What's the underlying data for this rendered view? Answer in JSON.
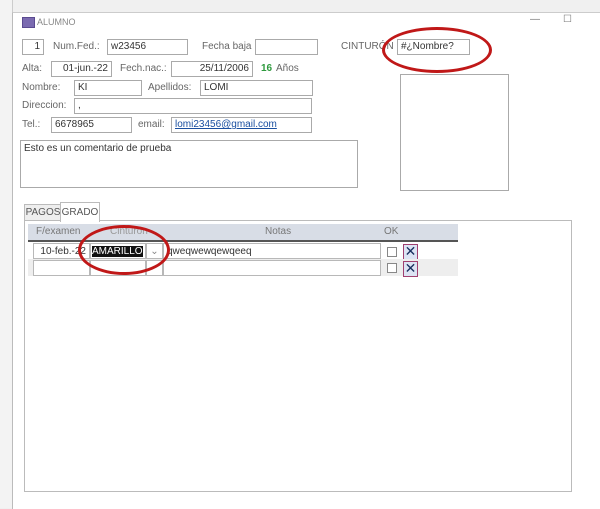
{
  "window": {
    "title": "ALUMNO",
    "minimize": "—",
    "maximize": "☐",
    "close": "✕"
  },
  "form": {
    "id": "1",
    "num_fed_label": "Num.Fed.:",
    "num_fed": "w23456",
    "fecha_baja_label": "Fecha baja",
    "fecha_baja": "",
    "cinturon_label": "CINTURÓN",
    "cinturon": "#¿Nombre?",
    "alta_label": "Alta:",
    "alta": "01-jun.-22",
    "fech_nac_label": "Fech.nac.:",
    "fech_nac": "25/11/2006",
    "edad": "16",
    "anos_label": "Años",
    "nombre_label": "Nombre:",
    "nombre": "KI",
    "apellidos_label": "Apellidos:",
    "apellidos": "LOMI",
    "direccion_label": "Direccion:",
    "direccion": ",",
    "tel_label": "Tel.:",
    "tel": "6678965",
    "email_label": "email:",
    "email": "lomi23456@gmail.com",
    "comentario": "Esto es un comentario de prueba"
  },
  "tabs": [
    {
      "label": "PAGOS"
    },
    {
      "label": "GRADO"
    }
  ],
  "grid": {
    "headers": [
      "F/examen",
      "Cinturón",
      "Notas",
      "OK"
    ],
    "rows": [
      {
        "fecha": "10-feb.-22",
        "cinturon": "AMARILLO",
        "notas": "qweqwewqewqeeq",
        "delete": "✕"
      },
      {
        "fecha": "",
        "cinturon": "",
        "notas": "",
        "delete": "✕"
      }
    ]
  },
  "colors": {
    "annotation": "#c01818",
    "age": "#2e9a3e",
    "link": "#1a4fa0"
  }
}
